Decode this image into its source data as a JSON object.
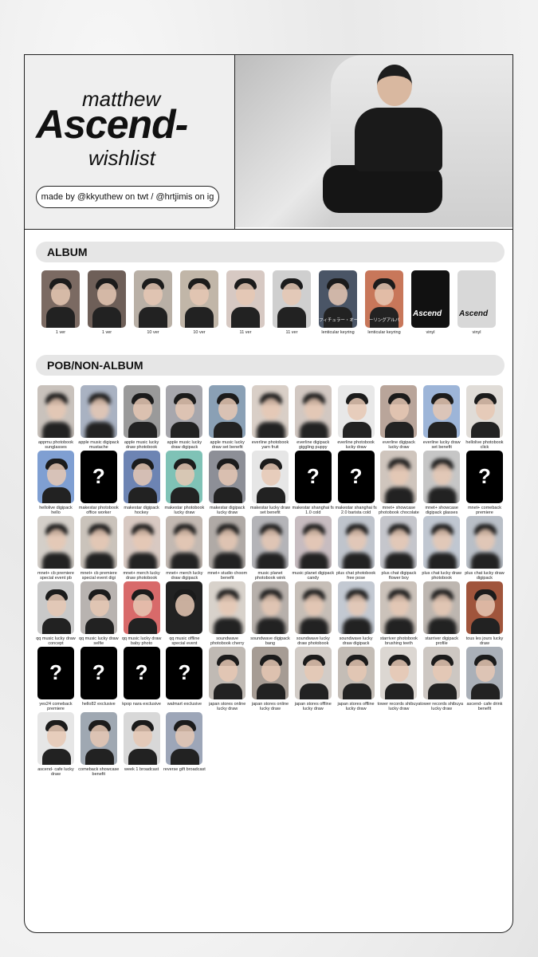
{
  "header": {
    "line1": "matthew",
    "line2": "Ascend-",
    "line3": "wishlist",
    "credit": "made by @kkyuthew on twt / @hrtjimis on ig"
  },
  "sections": {
    "album_title": "ALBUM",
    "pob_title": "POB/NON-ALBUM"
  },
  "album": [
    {
      "label": "1 ver",
      "bg": "#7b6a62",
      "type": "photo"
    },
    {
      "label": "1 ver",
      "bg": "#6e5f58",
      "type": "photo"
    },
    {
      "label": "10 ver",
      "bg": "#b9b0a6",
      "type": "photo"
    },
    {
      "label": "10 ver",
      "bg": "#c1b6a8",
      "type": "photo"
    },
    {
      "label": "11 ver",
      "bg": "#d7c9c3",
      "type": "photo"
    },
    {
      "label": "11 ver",
      "bg": "#cfcfcf",
      "type": "photo"
    },
    {
      "label": "lenticular keyring",
      "bg": "#4a5566",
      "type": "photo",
      "overlay": "フィチュラー・オーリング"
    },
    {
      "label": "lenticular keyring",
      "bg": "#c8775a",
      "type": "photo",
      "overlay": "ーリングアルバ"
    },
    {
      "label": "vinyl",
      "bg": "#111",
      "type": "vinyl",
      "overlay": "Ascend"
    },
    {
      "label": "vinyl",
      "bg": "#d8d8d8",
      "type": "vinyl2",
      "overlay": "Ascend"
    }
  ],
  "pob": [
    {
      "label": "appmu photobook sunglasses",
      "bg": "#c9c2bc",
      "blur": true
    },
    {
      "label": "apple music digipack mustache",
      "bg": "#a9b2c2",
      "blur": true
    },
    {
      "label": "apple music lucky draw photobook",
      "bg": "#9a9a9a"
    },
    {
      "label": "apple music lucky draw digipack",
      "bg": "#a7a7ad"
    },
    {
      "label": "apple music lucky draw set benefit",
      "bg": "#8aa0b5"
    },
    {
      "label": "everline photobook yarn fruit",
      "bg": "#d9cfc7",
      "blur": true
    },
    {
      "label": "everline digipack giggling puppy",
      "bg": "#d2c8c2",
      "blur": true
    },
    {
      "label": "everline photobook lucky draw",
      "bg": "#e8e8e8"
    },
    {
      "label": "everline digipack lucky draw",
      "bg": "#b9a59a"
    },
    {
      "label": "everline lucky draw set benefit",
      "bg": "#9db5d8"
    },
    {
      "label": "hellolive photobook click",
      "bg": "#e0dcd7"
    },
    {
      "label": "hellolive digipack hello",
      "bg": "#7f9fd2"
    },
    {
      "label": "makestar photobook office worker",
      "type": "unknown"
    },
    {
      "label": "makestar digipack hockey",
      "bg": "#6d84b3"
    },
    {
      "label": "makestar photobook lucky draw",
      "bg": "#7fc2b6"
    },
    {
      "label": "makestar digipack lucky draw",
      "bg": "#8d8f97"
    },
    {
      "label": "makestar lucky draw set benefit",
      "bg": "#e6e6e6"
    },
    {
      "label": "makestar shanghai fs 1.0 cold",
      "type": "unknown"
    },
    {
      "label": "makestar shanghai fs 2.0 barista cold",
      "type": "unknown"
    },
    {
      "label": "mnet+ showcase photobook chocolate",
      "bg": "#cfc5bd",
      "blur": true
    },
    {
      "label": "mnet+ showcase digipack glasses",
      "bg": "#c6c6c6",
      "blur": true
    },
    {
      "label": "mnet+ comeback premiere",
      "type": "unknown"
    },
    {
      "label": "mnet+ cb premiere special event pb",
      "bg": "#d4cfc9",
      "blur": true
    },
    {
      "label": "mnet+ cb premiere special event digi",
      "bg": "#cac3bb",
      "blur": true
    },
    {
      "label": "mnet+ merch lucky draw photobook",
      "bg": "#d8c9c2",
      "blur": true
    },
    {
      "label": "mnet+ merch lucky draw digipack",
      "bg": "#c3b9b2",
      "blur": true
    },
    {
      "label": "mnet+ studio choom benefit",
      "bg": "#b0aaa6",
      "blur": true
    },
    {
      "label": "music planet photobook wink",
      "bg": "#b4b4b8",
      "blur": true
    },
    {
      "label": "music planet digipack candy",
      "bg": "#c7bcc0",
      "blur": true
    },
    {
      "label": "plus chat photobook free pose",
      "bg": "#bfc4cc",
      "blur": true
    },
    {
      "label": "plus chat digipack flower boy",
      "bg": "#c5c6cc",
      "blur": true
    },
    {
      "label": "plus chat lucky draw photobook",
      "bg": "#c0c7d1",
      "blur": true
    },
    {
      "label": "plus chat lucky draw digipack",
      "bg": "#b9bfc7",
      "blur": true
    },
    {
      "label": "qq music lucky draw concept",
      "bg": "#c9c9c9"
    },
    {
      "label": "qq music lucky draw selfie",
      "bg": "#b8b3b0"
    },
    {
      "label": "qq music lucky draw baby photo",
      "bg": "#d86a6a"
    },
    {
      "label": "qq music offline special event",
      "bg": "#222"
    },
    {
      "label": "soundwave photobook cherry",
      "bg": "#d8d2cb",
      "blur": true
    },
    {
      "label": "soundwave digipack bang",
      "bg": "#b7b0ab",
      "blur": true
    },
    {
      "label": "soundwave lucky draw photobook",
      "bg": "#c6beb7",
      "blur": true
    },
    {
      "label": "soundwave lucky draw digipack",
      "bg": "#c3c9d2",
      "blur": true
    },
    {
      "label": "starriver photobook brushing teeth",
      "bg": "#cbc2ba",
      "blur": true
    },
    {
      "label": "starriver digipack profile",
      "bg": "#bdb6b0",
      "blur": true
    },
    {
      "label": "tous les jours lucky draw",
      "bg": "#a0553c"
    },
    {
      "label": "yes24 comeback premiere",
      "type": "unknown"
    },
    {
      "label": "hello82 exclusive",
      "type": "unknown"
    },
    {
      "label": "kpop nara exclusive",
      "type": "unknown"
    },
    {
      "label": "walmart exclusive",
      "type": "unknown"
    },
    {
      "label": "japan stores online lucky draw",
      "bg": "#c0bab4"
    },
    {
      "label": "japan stores online lucky draw",
      "bg": "#a69c94"
    },
    {
      "label": "japan stores offline lucky draw",
      "bg": "#d2ccc7"
    },
    {
      "label": "japan stores offline lucky draw",
      "bg": "#c4bdb6"
    },
    {
      "label": "tower records shibuya lucky draw",
      "bg": "#dcd7d2"
    },
    {
      "label": "tower records shibuya lucky draw",
      "bg": "#cdc7c2"
    },
    {
      "label": "ascend- cafe drink benefit",
      "bg": "#aab0b8"
    },
    {
      "label": "ascend- cafe lucky draw",
      "bg": "#e6e6e6"
    },
    {
      "label": "comeback showcase benefit",
      "bg": "#9fa8b2"
    },
    {
      "label": "week 1 broadcast",
      "bg": "#d8d8d8"
    },
    {
      "label": "reverse gift broadcast",
      "bg": "#9da6b8"
    }
  ],
  "unknown_glyph": "?",
  "colors": {
    "border": "#222222",
    "bar": "#e6e6e6",
    "header_bg": "#efefef"
  }
}
